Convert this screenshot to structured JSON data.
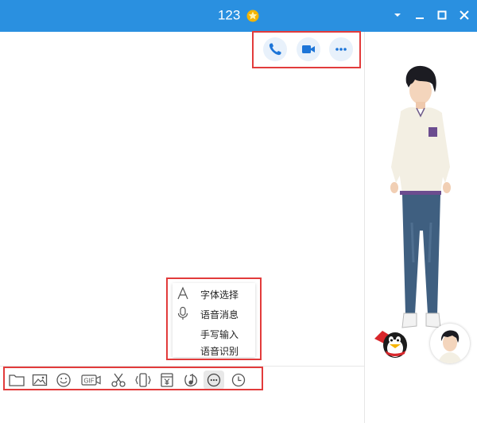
{
  "window": {
    "title": "123",
    "titlebar_color": "#2a90e0",
    "star_icon": "star-badge-icon"
  },
  "window_controls": [
    "dropdown-arrow-icon",
    "minimize-icon",
    "maximize-icon",
    "close-icon"
  ],
  "call_actions": [
    "phone-icon",
    "video-camera-icon",
    "more-dots-icon"
  ],
  "popup_menu": {
    "items": [
      {
        "label": "字体选择",
        "icon": "font-a-icon"
      },
      {
        "label": "语音消息",
        "icon": "microphone-icon"
      },
      {
        "label": "手写输入",
        "icon": ""
      },
      {
        "label": "语音识别",
        "icon": ""
      }
    ]
  },
  "toolbar": {
    "gif_label": "GIF",
    "tools": [
      "folder-icon",
      "image-icon",
      "emoji-icon",
      "gif-icon",
      "scissors-icon",
      "shake-icon",
      "red-packet-icon",
      "music-icon",
      "more-icon",
      "history-clock-icon"
    ]
  },
  "annotation_color": "#e23b3b"
}
